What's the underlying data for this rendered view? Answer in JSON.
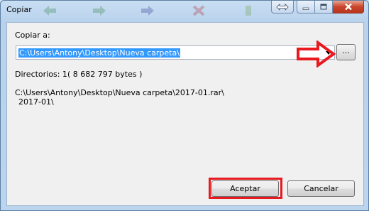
{
  "window": {
    "title": "Copiar"
  },
  "form": {
    "copy_to_label": "Copiar a:",
    "path_value": "C:\\Users\\Antony\\Desktop\\Nueva carpeta\\",
    "browse_label": "...",
    "directories_label": "Directorios: 1",
    "directories_size": "( 8 682 797 bytes )",
    "file_path_line1": "C:\\Users\\Antony\\Desktop\\Nueva carpeta\\2017-01.rar\\",
    "file_path_line2": "2017-01\\"
  },
  "buttons": {
    "ok_label": "Aceptar",
    "cancel_label": "Cancelar"
  },
  "colors": {
    "annotation": "#e8191f",
    "selection": "#3399ff"
  }
}
